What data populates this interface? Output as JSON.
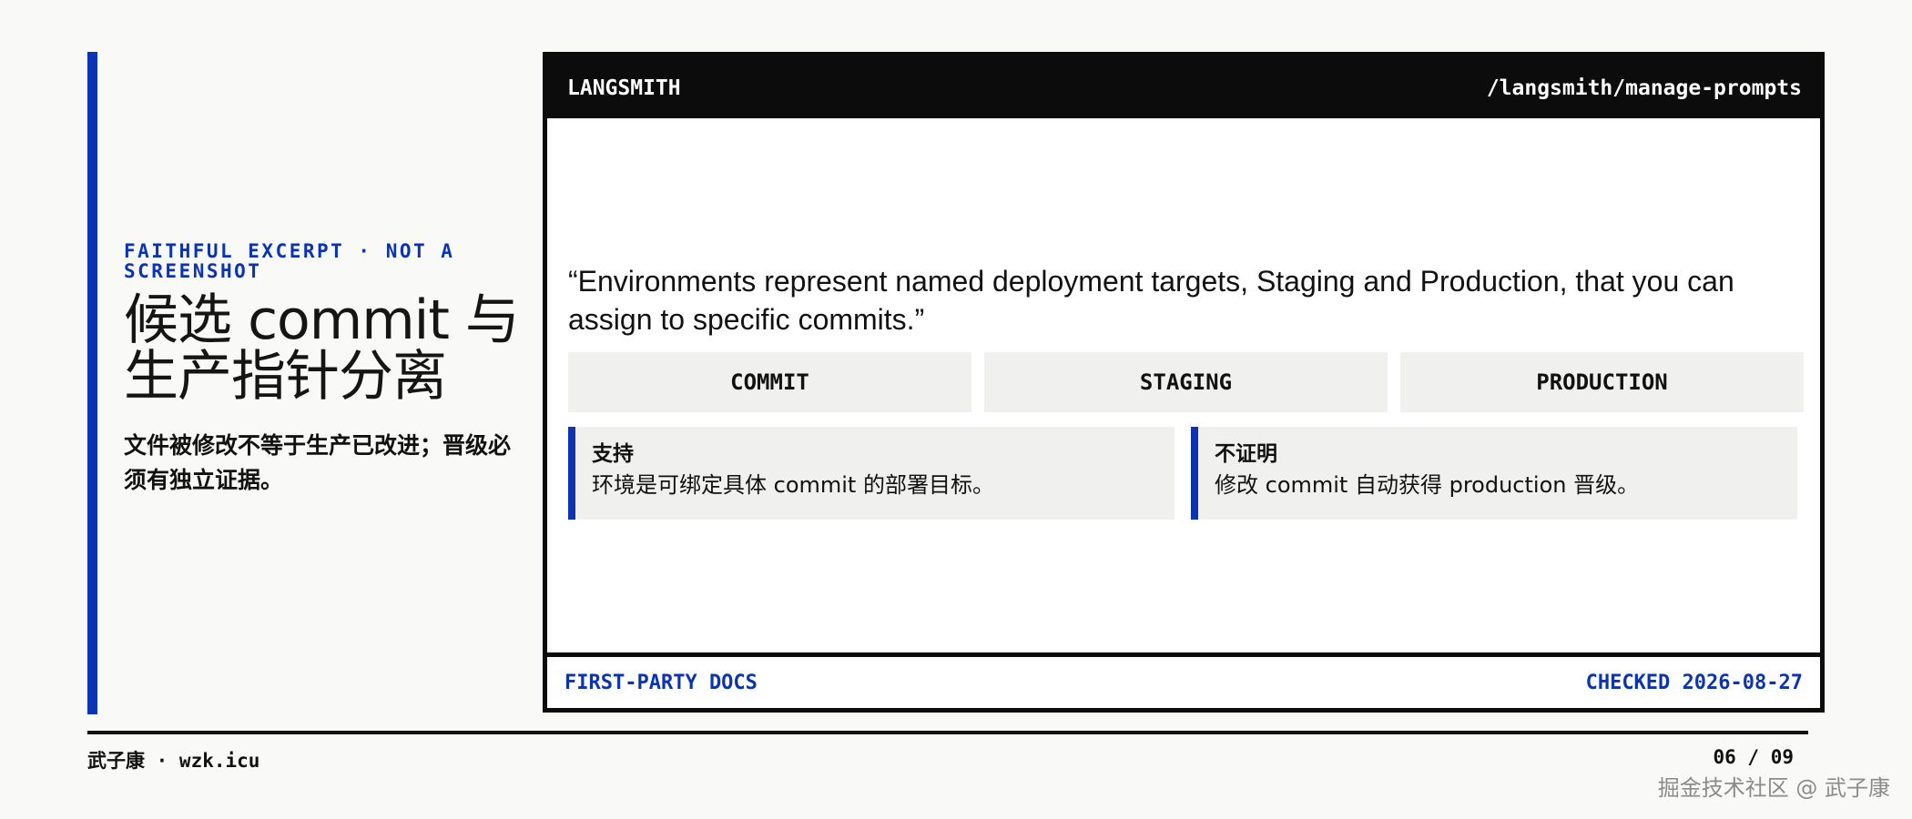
{
  "left": {
    "eyebrow": "FAITHFUL EXCERPT · NOT A SCREENSHOT",
    "title": "候选 commit 与生产指针分离",
    "lede": "文件被修改不等于生产已改进；晋级必须有独立证据。"
  },
  "panel": {
    "brand": "LANGSMITH",
    "path": "/langsmith/manage-prompts",
    "quote": "“Environments represent named deployment targets, Staging and Production, that you can assign to specific commits.”",
    "columns": [
      "COMMIT",
      "STAGING",
      "PRODUCTION"
    ],
    "cards": [
      {
        "key": "支持",
        "value": "环境是可绑定具体 commit 的部署目标。"
      },
      {
        "key": "不证明",
        "value": "修改 commit 自动获得 production 晋级。"
      }
    ],
    "footer_left": "FIRST-PARTY DOCS",
    "footer_right": "CHECKED 2026-08-27"
  },
  "footer": {
    "author": "武子康 · wzk.icu",
    "page": "06 / 09",
    "watermark": "掘金技术社区 @ 武子康"
  },
  "colors": {
    "accent": "#0a33b8",
    "ink": "#0c0c0c",
    "panel_bg": "#ffffff",
    "cell_bg": "#f0f0ef"
  }
}
